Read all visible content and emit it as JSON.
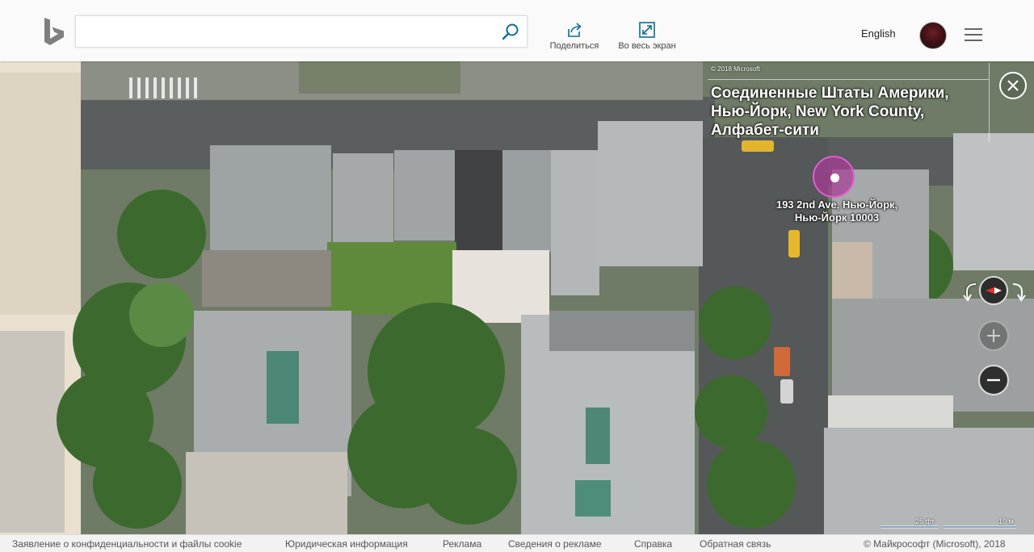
{
  "header": {
    "search": {
      "value": "",
      "placeholder": ""
    },
    "share_label": "Поделиться",
    "fullscreen_label": "Во весь экран",
    "language_label": "English"
  },
  "location": {
    "copyright_small": "© 2018 Microsoft",
    "title": "Соединенные Штаты Америки, Нью-Йорк, New York County, Алфабет-сити",
    "pin_label_line1": "193 2nd Ave, Нью-Йорк,",
    "pin_label_line2": "Нью-Йорк 10003"
  },
  "map": {
    "view_type": "aerial",
    "pin_color": "#b04aa0",
    "scale_ft": "25 фт",
    "scale_m": "10 м"
  },
  "footer": {
    "links": [
      "Заявление о конфиденциальности и файлы cookie",
      "Юридическая информация",
      "Реклама",
      "Сведения о рекламе",
      "Справка",
      "Обратная связь"
    ],
    "copyright": "© Майкрософт (Microsoft), 2018"
  }
}
